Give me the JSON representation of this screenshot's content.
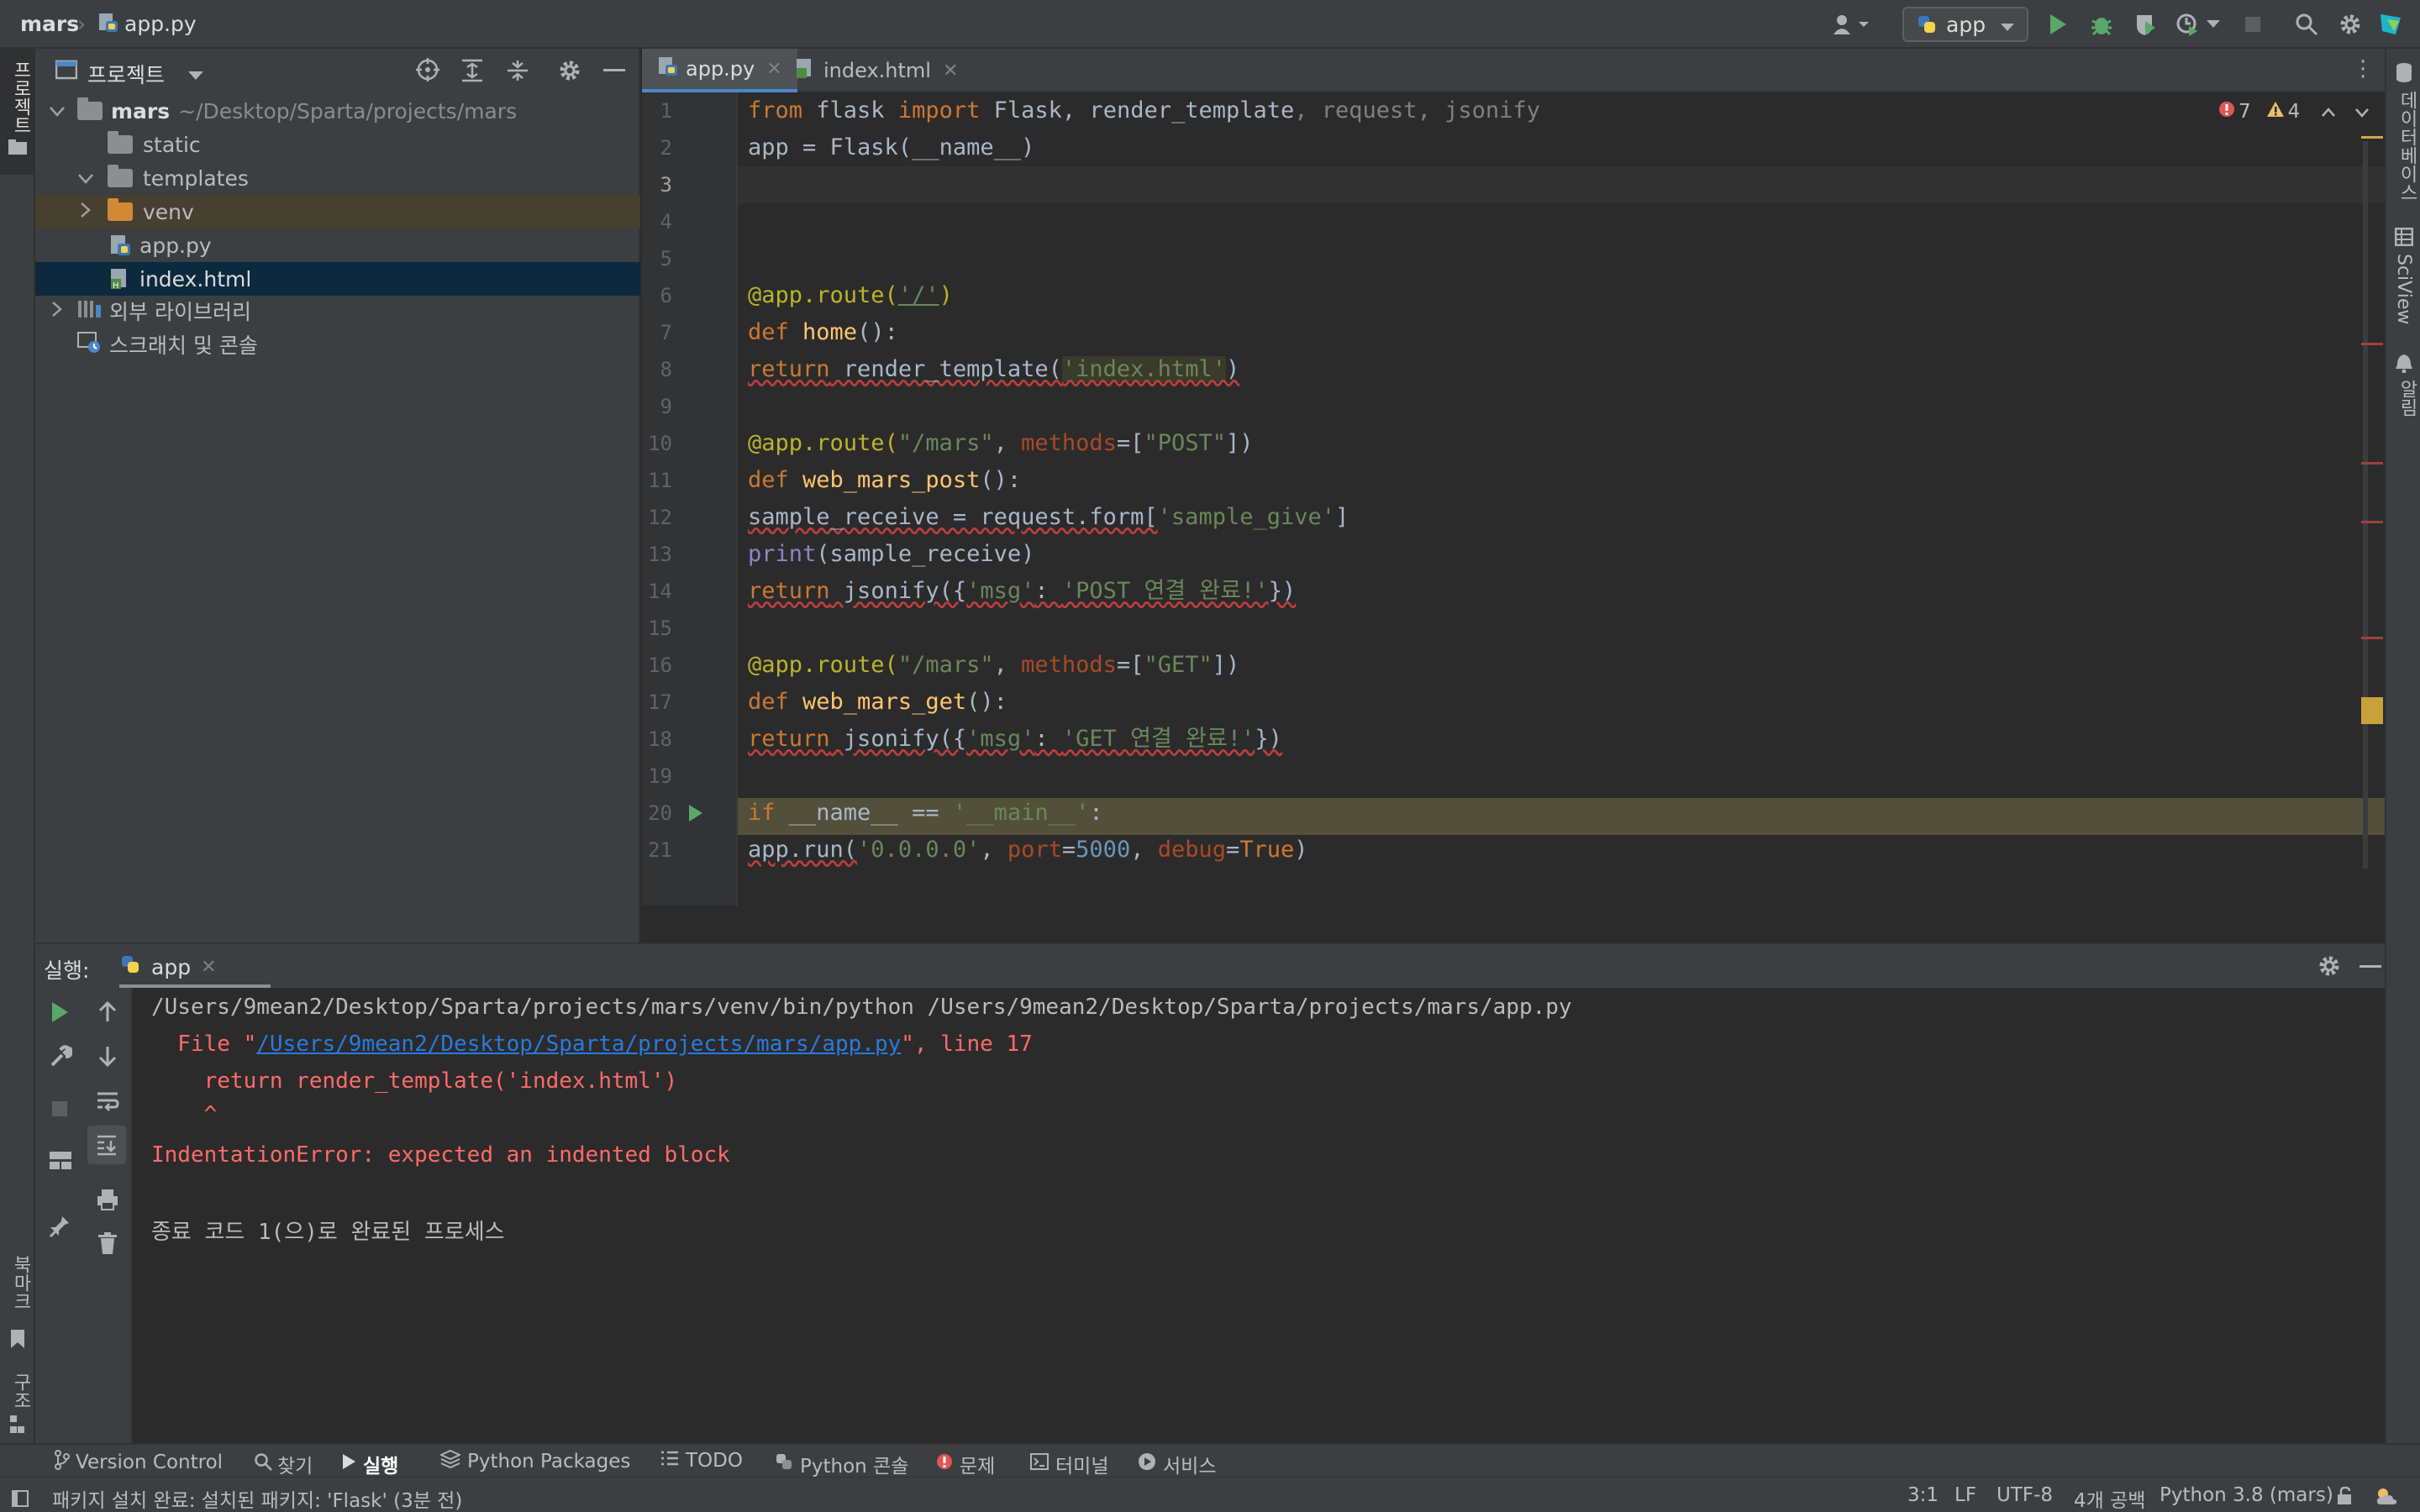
{
  "top": {
    "project": "mars",
    "file": "app.py",
    "run_config": "app"
  },
  "project_panel": {
    "title": "프로젝트",
    "tree": [
      {
        "label": "mars",
        "path": "~/Desktop/Sparta/projects/mars"
      },
      {
        "label": "static"
      },
      {
        "label": "templates"
      },
      {
        "label": "venv"
      },
      {
        "label": "app.py"
      },
      {
        "label": "index.html"
      },
      {
        "label": "외부 라이브러리"
      },
      {
        "label": "스크래치 및 콘솔"
      }
    ]
  },
  "left_strip": {
    "project": "프로젝트",
    "bookmarks": "북마크",
    "structure": "구조"
  },
  "right_strip": {
    "database": "데이터베이스",
    "sciview": "SciView",
    "notifications": "알림"
  },
  "tabs": [
    {
      "label": "app.py"
    },
    {
      "label": "index.html"
    }
  ],
  "inspection": {
    "errors": "7",
    "warnings": "4"
  },
  "line_numbers": [
    "1",
    "2",
    "3",
    "4",
    "5",
    "6",
    "7",
    "8",
    "9",
    "10",
    "11",
    "12",
    "13",
    "14",
    "15",
    "16",
    "17",
    "18",
    "19",
    "20",
    "21"
  ],
  "code": {
    "l1": {
      "a": "from",
      "b": " flask ",
      "c": "import",
      "d": " Flask",
      "e": ", render_template",
      "f": ", request, jsonify"
    },
    "l2": "app = Flask(__name__)",
    "l6": {
      "a": "@app.route(",
      "b": "'/'",
      "c": ")"
    },
    "l7": {
      "a": "def",
      "b": " home",
      "c": "():"
    },
    "l8": {
      "a": "return",
      "b": " render_template(",
      "c": "'index.html'",
      "d": ")"
    },
    "l10": {
      "a": "@app.route(",
      "b": "\"/mars\"",
      "c": ", ",
      "d": "methods",
      "e": "=[",
      "f": "\"POST\"",
      "g": "])"
    },
    "l11": {
      "a": "def",
      "b": " web_mars_post",
      "c": "():"
    },
    "l12": {
      "a": "sample_receive = request.form[",
      "b": "'sample_give'",
      "c": "]"
    },
    "l13": {
      "a": "print",
      "b": "(sample_receive)"
    },
    "l14": {
      "a": "return",
      "b": " jsonify({",
      "c": "'msg'",
      "d": ": ",
      "e": "'POST 연결 완료!'",
      "f": "})"
    },
    "l16": {
      "a": "@app.route(",
      "b": "\"/mars\"",
      "c": ", ",
      "d": "methods",
      "e": "=[",
      "f": "\"GET\"",
      "g": "])"
    },
    "l17": {
      "a": "def",
      "b": " web_mars_get",
      "c": "():"
    },
    "l18": {
      "a": "return",
      "b": " jsonify({",
      "c": "'msg'",
      "d": ": ",
      "e": "'GET 연결 완료!'",
      "f": "})"
    },
    "l20": {
      "a": "if",
      "b": " __name__ == ",
      "c": "'__main__'",
      "d": ":"
    },
    "l21": {
      "a": "app.run(",
      "b": "'0.0.0.0'",
      "c": ", ",
      "d": "port",
      "e": "=",
      "f": "5000",
      "g": ", ",
      "h": "debug",
      "i": "=",
      "j": "True",
      "k": ")"
    }
  },
  "run": {
    "label": "실행:",
    "tab": "app",
    "lines": {
      "cmd": "/Users/9mean2/Desktop/Sparta/projects/mars/venv/bin/python /Users/9mean2/Desktop/Sparta/projects/mars/app.py",
      "file_prefix": "  File \"",
      "file_link": "/Users/9mean2/Desktop/Sparta/projects/mars/app.py",
      "file_suffix": "\", line 17",
      "code": "    return render_template('index.html')",
      "caret": "    ^",
      "error": "IndentationError: expected an indented block",
      "exit": "종료 코드 1(으)로 완료된 프로세스"
    }
  },
  "bottom_tools": [
    "Version Control",
    "찾기",
    "실행",
    "Python Packages",
    "TODO",
    "Python 콘솔",
    "문제",
    "터미널",
    "서비스"
  ],
  "status": {
    "message": "패키지 설치 완료: 설치된 패키지: 'Flask' (3분 전)",
    "position": "3:1",
    "line_sep": "LF",
    "encoding": "UTF-8",
    "indent": "4개 공백",
    "interpreter": "Python 3.8 (mars)"
  },
  "colors": {
    "accent": "#4a88c7",
    "error": "#ff6b68",
    "run_green": "#59a869"
  }
}
